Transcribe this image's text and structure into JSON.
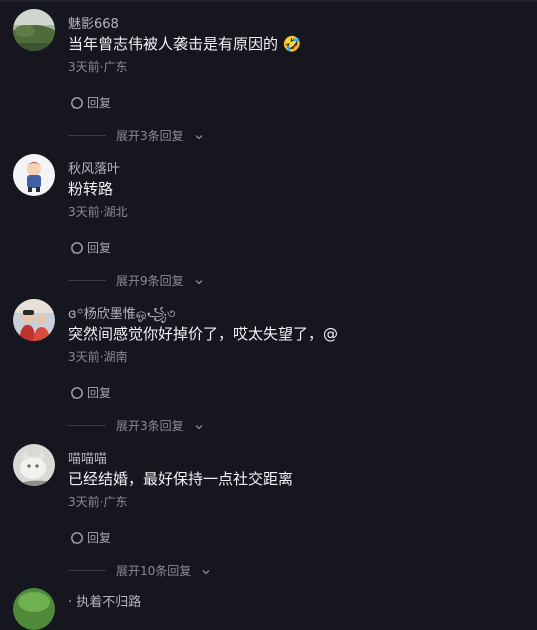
{
  "comments": [
    {
      "username": "魅影668",
      "content": "当年曾志伟被人袭击是有原因的 🤣",
      "meta": "3天前·广东",
      "reply_label": "回复",
      "expand_label": "展开3条回复"
    },
    {
      "username": "秋风落叶",
      "content": "粉转路",
      "meta": "3天前·湖北",
      "reply_label": "回复",
      "expand_label": "展开9条回复"
    },
    {
      "username": "ɞ꙳杨欣墨惟ஓ꧁৩",
      "content": "突然间感觉你好掉价了，哎太失望了，@",
      "meta": "3天前·湖南",
      "reply_label": "回复",
      "expand_label": "展开3条回复"
    },
    {
      "username": "喵喵喵",
      "content": "已经结婚，最好保持一点社交距离",
      "meta": "3天前·广东",
      "reply_label": "回复",
      "expand_label": "展开10条回复"
    }
  ],
  "partial_username": "· 执着不归路"
}
